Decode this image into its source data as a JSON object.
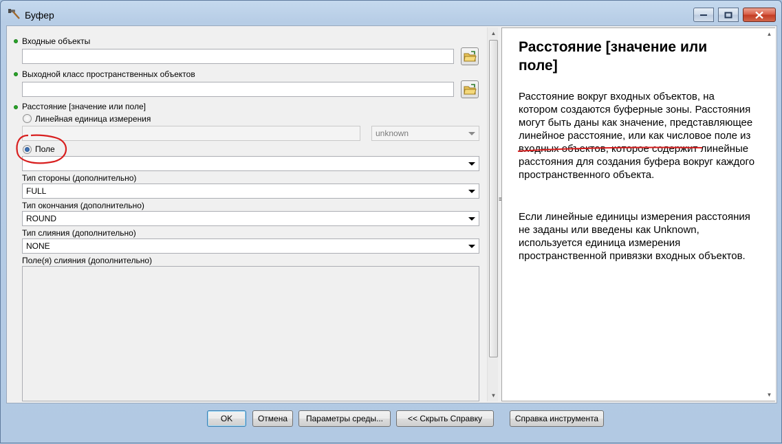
{
  "window": {
    "title": "Буфер",
    "icon": "hammer-icon"
  },
  "form": {
    "input_features_label": "Входные объекты",
    "input_features_value": "",
    "output_fc_label": "Выходной класс пространственных объектов",
    "output_fc_value": "",
    "distance_label": "Расстояние [значение или поле]",
    "linear_unit_label": "Линейная единица измерения",
    "linear_unit_value": "",
    "unit_select_value": "unknown",
    "field_label": "Поле",
    "field_select_value": "",
    "side_type_label": "Тип стороны (дополнительно)",
    "side_type_value": "FULL",
    "end_type_label": "Тип окончания (дополнительно)",
    "end_type_value": "ROUND",
    "dissolve_type_label": "Тип слияния (дополнительно)",
    "dissolve_type_value": "NONE",
    "dissolve_fields_label": "Поле(я) слияния (дополнительно)"
  },
  "help": {
    "title": "Расстояние [значение или поле]",
    "p1": "Расстояние вокруг входных объектов, на котором создаются буферные зоны. Расстояния могут быть даны как значение, представляющее линейное расстояние, или как числовое поле из входных объектов, которое содержит линейные расстояния для создания буфера вокруг каждого пространственного объекта.",
    "p2": "Если линейные единицы измерения расстояния не заданы или введены как Unknown, используется единица измерения пространственной привязки входных объектов."
  },
  "buttons": {
    "ok": "OK",
    "cancel": "Отмена",
    "environments": "Параметры среды...",
    "hide_help": "<< Скрыть Справку",
    "tool_help": "Справка инструмента"
  },
  "colors": {
    "required_dot": "#2aa52a",
    "annotation_red": "#d81e1e"
  }
}
